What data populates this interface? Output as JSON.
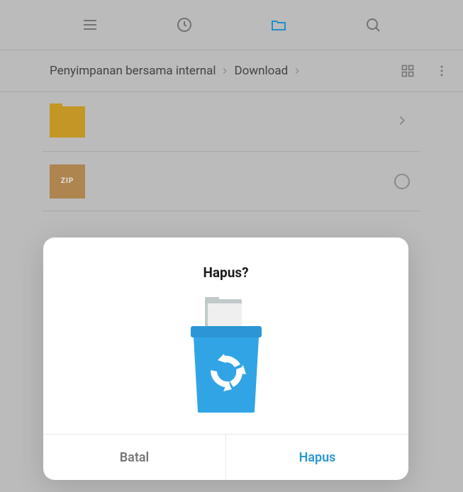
{
  "toolbar": {},
  "breadcrumb": {
    "parent": "Penyimpanan bersama internal",
    "current": "Download"
  },
  "files": {
    "zip_label": "ZIP"
  },
  "dialog": {
    "title": "Hapus?",
    "cancel_label": "Batal",
    "confirm_label": "Hapus"
  }
}
